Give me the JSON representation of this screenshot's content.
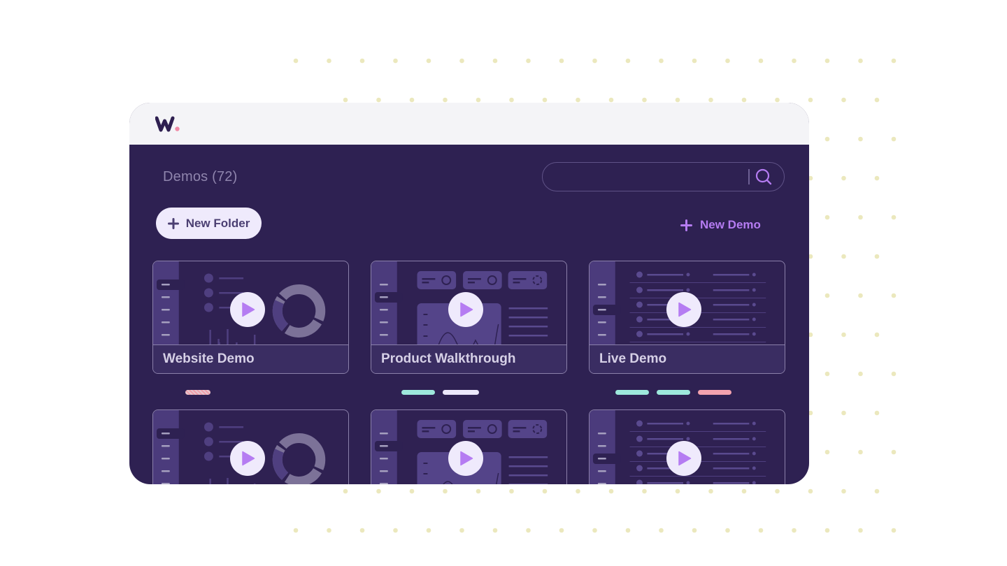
{
  "app": {
    "logo": {
      "icon": "brand-w-logo-icon",
      "letter": "W",
      "accent_dot_color": "#f08aa6"
    }
  },
  "colors": {
    "window_body": "#2e2152",
    "window_header": "#f4f4f7",
    "accent_purple": "#b57cf2",
    "pill_light": "#efeafc",
    "background_dots": "#ebe8bd"
  },
  "header": {
    "title": "Demos (72)"
  },
  "search": {
    "value": "",
    "placeholder": "",
    "icon": "search-icon"
  },
  "actions": {
    "new_folder_label": "New Folder",
    "new_folder_icon": "plus-icon",
    "new_demo_label": "New Demo",
    "new_demo_icon": "plus-icon"
  },
  "demos": [
    {
      "title": "Website Demo",
      "thumbnail": "dashboard-donut",
      "tags": [
        {
          "color": "#f0a0ab",
          "style": "hatched"
        }
      ]
    },
    {
      "title": "Product Walkthrough",
      "thumbnail": "dashboard-widgets",
      "tags": [
        {
          "color": "#9ee8dc"
        },
        {
          "color": "#ece8fb"
        }
      ]
    },
    {
      "title": "Live Demo",
      "thumbnail": "dashboard-list",
      "tags": [
        {
          "color": "#9ee8dc"
        },
        {
          "color": "#9ee8dc"
        },
        {
          "color": "#f3a2ae"
        }
      ]
    },
    {
      "title": "",
      "thumbnail": "dashboard-donut",
      "tags": []
    },
    {
      "title": "",
      "thumbnail": "dashboard-widgets",
      "tags": []
    },
    {
      "title": "",
      "thumbnail": "dashboard-list",
      "tags": []
    }
  ]
}
